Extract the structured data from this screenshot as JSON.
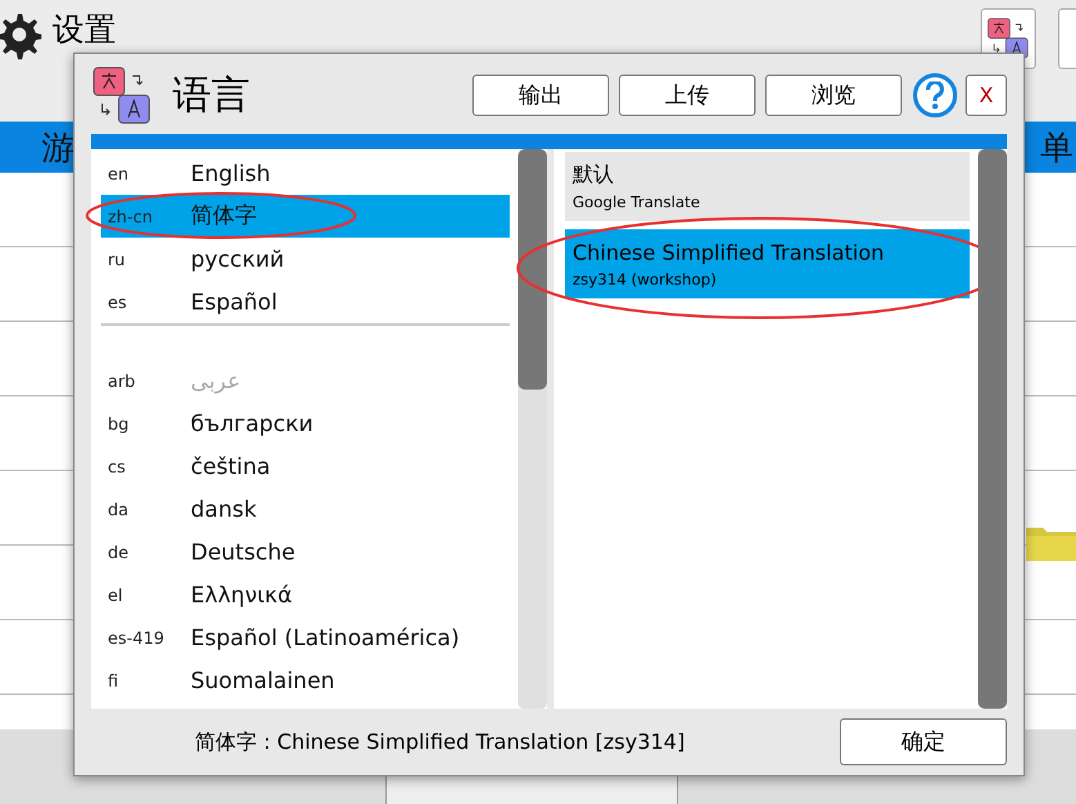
{
  "background": {
    "title": "设置",
    "tab_left": "游",
    "tab_right": "单"
  },
  "dialog": {
    "title": "语言",
    "buttons": [
      {
        "label": "输出"
      },
      {
        "label": "上传"
      },
      {
        "label": "浏览"
      }
    ],
    "close": "X",
    "languages": [
      {
        "code": "en",
        "name": "English",
        "selected": false,
        "disabled": false,
        "circled": false,
        "divider_after": false
      },
      {
        "code": "zh-cn",
        "name": "简体字",
        "selected": true,
        "disabled": false,
        "circled": true,
        "divider_after": false
      },
      {
        "code": "ru",
        "name": "русский",
        "selected": false,
        "disabled": false,
        "circled": false,
        "divider_after": false
      },
      {
        "code": "es",
        "name": "Español",
        "selected": false,
        "disabled": false,
        "circled": false,
        "divider_after": true
      },
      {
        "code": "arb",
        "name": "عربى",
        "selected": false,
        "disabled": true,
        "circled": false,
        "divider_after": false
      },
      {
        "code": "bg",
        "name": "български",
        "selected": false,
        "disabled": false,
        "circled": false,
        "divider_after": false
      },
      {
        "code": "cs",
        "name": "čeština",
        "selected": false,
        "disabled": false,
        "circled": false,
        "divider_after": false
      },
      {
        "code": "da",
        "name": "dansk",
        "selected": false,
        "disabled": false,
        "circled": false,
        "divider_after": false
      },
      {
        "code": "de",
        "name": "Deutsche",
        "selected": false,
        "disabled": false,
        "circled": false,
        "divider_after": false
      },
      {
        "code": "el",
        "name": "Ελληνικά",
        "selected": false,
        "disabled": false,
        "circled": false,
        "divider_after": false
      },
      {
        "code": "es-419",
        "name": "Español (Latinoamérica)",
        "selected": false,
        "disabled": false,
        "circled": false,
        "divider_after": false
      },
      {
        "code": "fi",
        "name": "Suomalainen",
        "selected": false,
        "disabled": false,
        "circled": false,
        "divider_after": false
      }
    ],
    "translations": [
      {
        "title": "默认",
        "author": "Google Translate",
        "selected": false,
        "circled": false
      },
      {
        "title": "Chinese Simplified Translation",
        "author": "zsy314 (workshop)",
        "selected": true,
        "circled": true
      }
    ],
    "status": "简体字 : Chinese Simplified Translation [zsy314]",
    "confirm": "确定"
  }
}
